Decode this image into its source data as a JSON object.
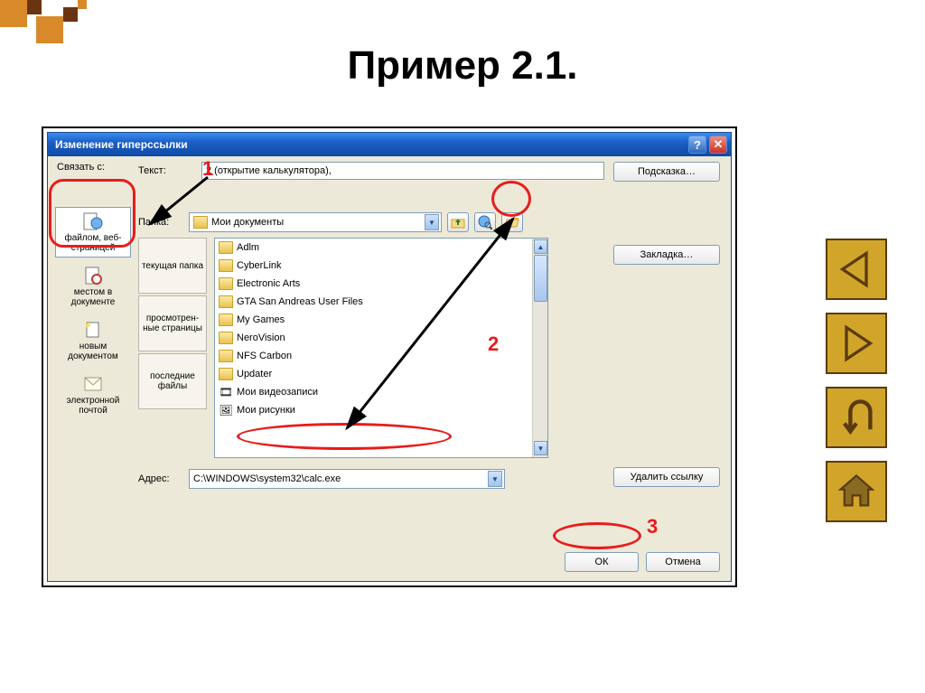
{
  "slide": {
    "title": "Пример 2.1."
  },
  "dialog": {
    "title": "Изменение гиперссылки",
    "linkto_label": "Связать с:",
    "text_label": "Текст:",
    "text_value": "2 (открытие калькулятора),",
    "tooltip_btn": "Подсказка…",
    "folder_label": "Папка:",
    "folder_value": "Мои документы",
    "bookmark_btn": "Закладка…",
    "delete_btn": "Удалить ссылку",
    "address_label": "Адрес:",
    "address_value": "C:\\WINDOWS\\system32\\calc.exe",
    "ok": "ОК",
    "cancel": "Отмена",
    "link_targets": [
      {
        "label": "файлом, веб-страницей"
      },
      {
        "label": "местом в документе"
      },
      {
        "label": "новым документом"
      },
      {
        "label": "электронной почтой"
      }
    ],
    "mid_nav": [
      {
        "label": "текущая папка"
      },
      {
        "label": "просмотрен-\nные страницы"
      },
      {
        "label": "последние файлы"
      }
    ],
    "files": [
      {
        "name": "Adlm",
        "type": "folder"
      },
      {
        "name": "CyberLink",
        "type": "folder"
      },
      {
        "name": "Electronic Arts",
        "type": "folder"
      },
      {
        "name": "GTA San Andreas User Files",
        "type": "folder"
      },
      {
        "name": "My Games",
        "type": "folder"
      },
      {
        "name": "NeroVision",
        "type": "folder"
      },
      {
        "name": "NFS Carbon",
        "type": "folder"
      },
      {
        "name": "Updater",
        "type": "folder"
      },
      {
        "name": "Мои видеозаписи",
        "type": "video"
      },
      {
        "name": "Мои рисунки",
        "type": "pictures"
      }
    ]
  },
  "annotations": {
    "n1": "1",
    "n2": "2",
    "n3": "3"
  }
}
